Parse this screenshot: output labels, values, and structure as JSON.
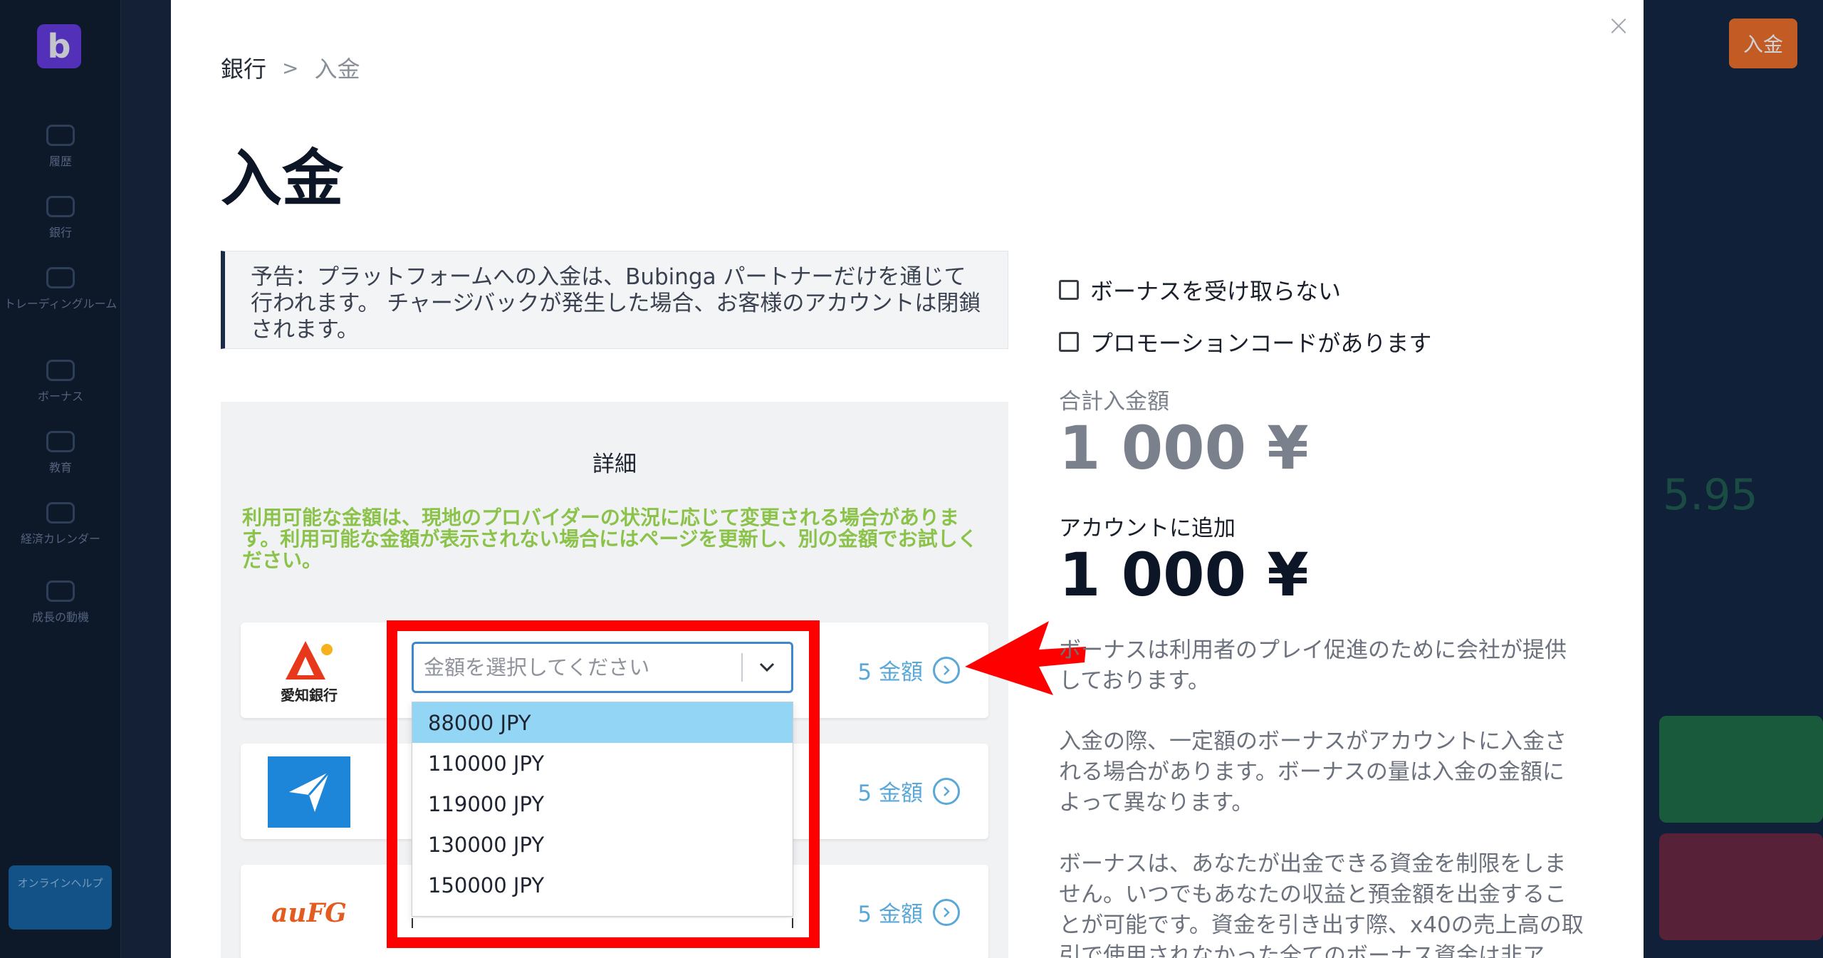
{
  "background": {
    "logo_letter": "b",
    "side_items": [
      "履歴",
      "銀行",
      "トレーディングルーム",
      "ボーナス",
      "教育",
      "経済カレンダー",
      "成長の動機"
    ],
    "help_label": "オンラインヘルプ",
    "deposit_button": "入金",
    "bg_number": "5.95"
  },
  "modal": {
    "close_glyph": "×",
    "breadcrumb": {
      "parent": "銀行",
      "separator": ">",
      "current": "入金"
    },
    "title": "入金",
    "notice": "予告：プラットフォームへの入金は、Bubinga パートナーだけを通じて行われます。 チャージバックが発生した場合、お客様のアカウントは閉鎖されます。",
    "details": {
      "title": "詳細",
      "warning": "利用可能な金額は、現地のプロバイダーの状況に応じて変更される場合があります。利用可能な金額が表示されない場合にはページを更新し、別の金額でお試しください。",
      "banks": [
        {
          "name": "愛知銀行",
          "amounts_label": "5 金額"
        },
        {
          "name": "",
          "amounts_label": "5 金額"
        },
        {
          "name": "auFG",
          "amounts_label": "5 金額"
        }
      ],
      "select": {
        "placeholder": "金額を選択してください",
        "options": [
          "88000 JPY",
          "110000 JPY",
          "119000 JPY",
          "130000 JPY",
          "150000 JPY"
        ],
        "highlighted_index": 0
      }
    },
    "right": {
      "checkbox_no_bonus": "ボーナスを受け取らない",
      "checkbox_promo": "プロモーションコードがあります",
      "total_label": "合計入金額",
      "total_value": "1 000 ¥",
      "add_label": "アカウントに追加",
      "add_value": "1 000 ¥",
      "paragraphs": [
        "ボーナスは利用者のプレイ促進のために会社が提供しております。",
        "入金の際、一定額のボーナスがアカウントに入金される場合があります。ボーナスの量は入金の金額によって異なります。",
        "ボーナスは、あなたが出金できる資金を制限をしません。いつでもあなたの収益と預金額を出金することが可能です。資金を引き出す際、x40の売上高の取引で使用されなかった全てのボーナス資金は非ア"
      ]
    }
  },
  "colors": {
    "highlight": "#ff0000",
    "accent_link": "#5aa8d8",
    "warning_green": "#8bc34a",
    "option_highlight": "#93d5f4"
  },
  "icons": [
    "close-icon",
    "chevron-down-icon",
    "chevron-right-circle-icon",
    "red-arrow-annotation"
  ]
}
